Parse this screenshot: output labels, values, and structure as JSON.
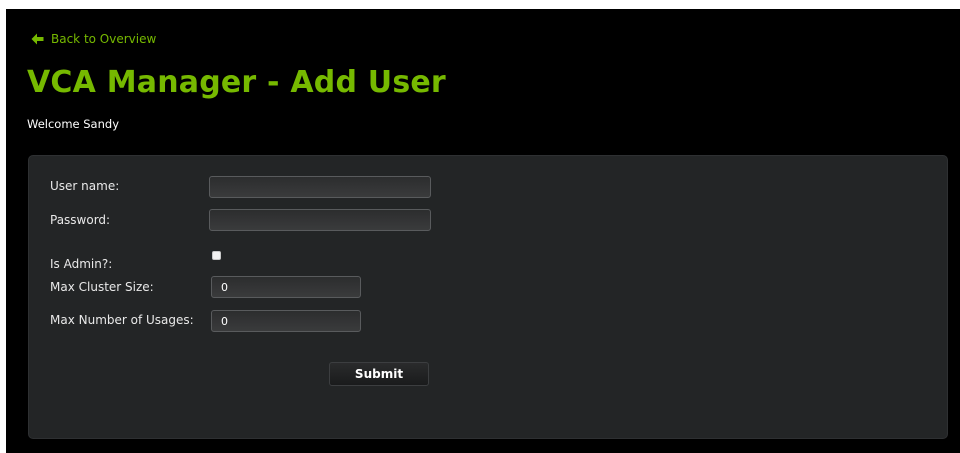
{
  "nav": {
    "back_label": "Back to Overview"
  },
  "header": {
    "title": "VCA Manager - Add User",
    "welcome": "Welcome Sandy"
  },
  "form": {
    "username_label": "User name:",
    "username_value": "",
    "password_label": "Password:",
    "password_value": "",
    "is_admin_label": "Is Admin?:",
    "is_admin_checked": false,
    "max_cluster_label": "Max Cluster Size:",
    "max_cluster_value": "0",
    "max_usages_label": "Max Number of Usages:",
    "max_usages_value": "0",
    "submit_label": "Submit"
  },
  "colors": {
    "accent": "#76b900",
    "background": "#000000",
    "panel": "#232526",
    "text": "#ffffff"
  },
  "icons": {
    "back": "arrow-left-icon"
  }
}
